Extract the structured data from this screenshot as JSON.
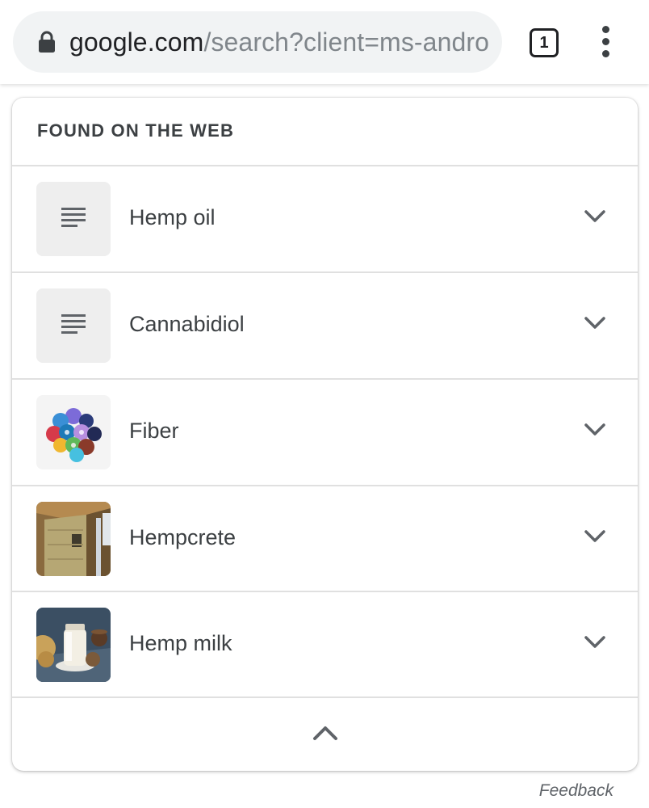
{
  "browser": {
    "url_host": "google.com",
    "url_path": "/search?client=ms-androic",
    "tab_count": "1",
    "icons": {
      "lock": "lock-icon",
      "tabs": "tab-switcher-icon",
      "menu": "more-vert-icon"
    }
  },
  "card": {
    "heading": "FOUND ON THE WEB",
    "items": [
      {
        "label": "Hemp oil",
        "thumb": "document-icon"
      },
      {
        "label": "Cannabidiol",
        "thumb": "document-icon"
      },
      {
        "label": "Fiber",
        "thumb": "yarn-balls-image"
      },
      {
        "label": "Hempcrete",
        "thumb": "hempcrete-wall-image"
      },
      {
        "label": "Hemp milk",
        "thumb": "milk-jar-image"
      }
    ],
    "expand_icon": "chevron-down-icon",
    "collapse_icon": "chevron-up-icon"
  },
  "feedback_label": "Feedback",
  "colors": {
    "omnibox_bg": "#f1f3f4",
    "thumb_bg": "#eeeeee",
    "text": "#3c4043",
    "divider": "#e0e0e0"
  }
}
